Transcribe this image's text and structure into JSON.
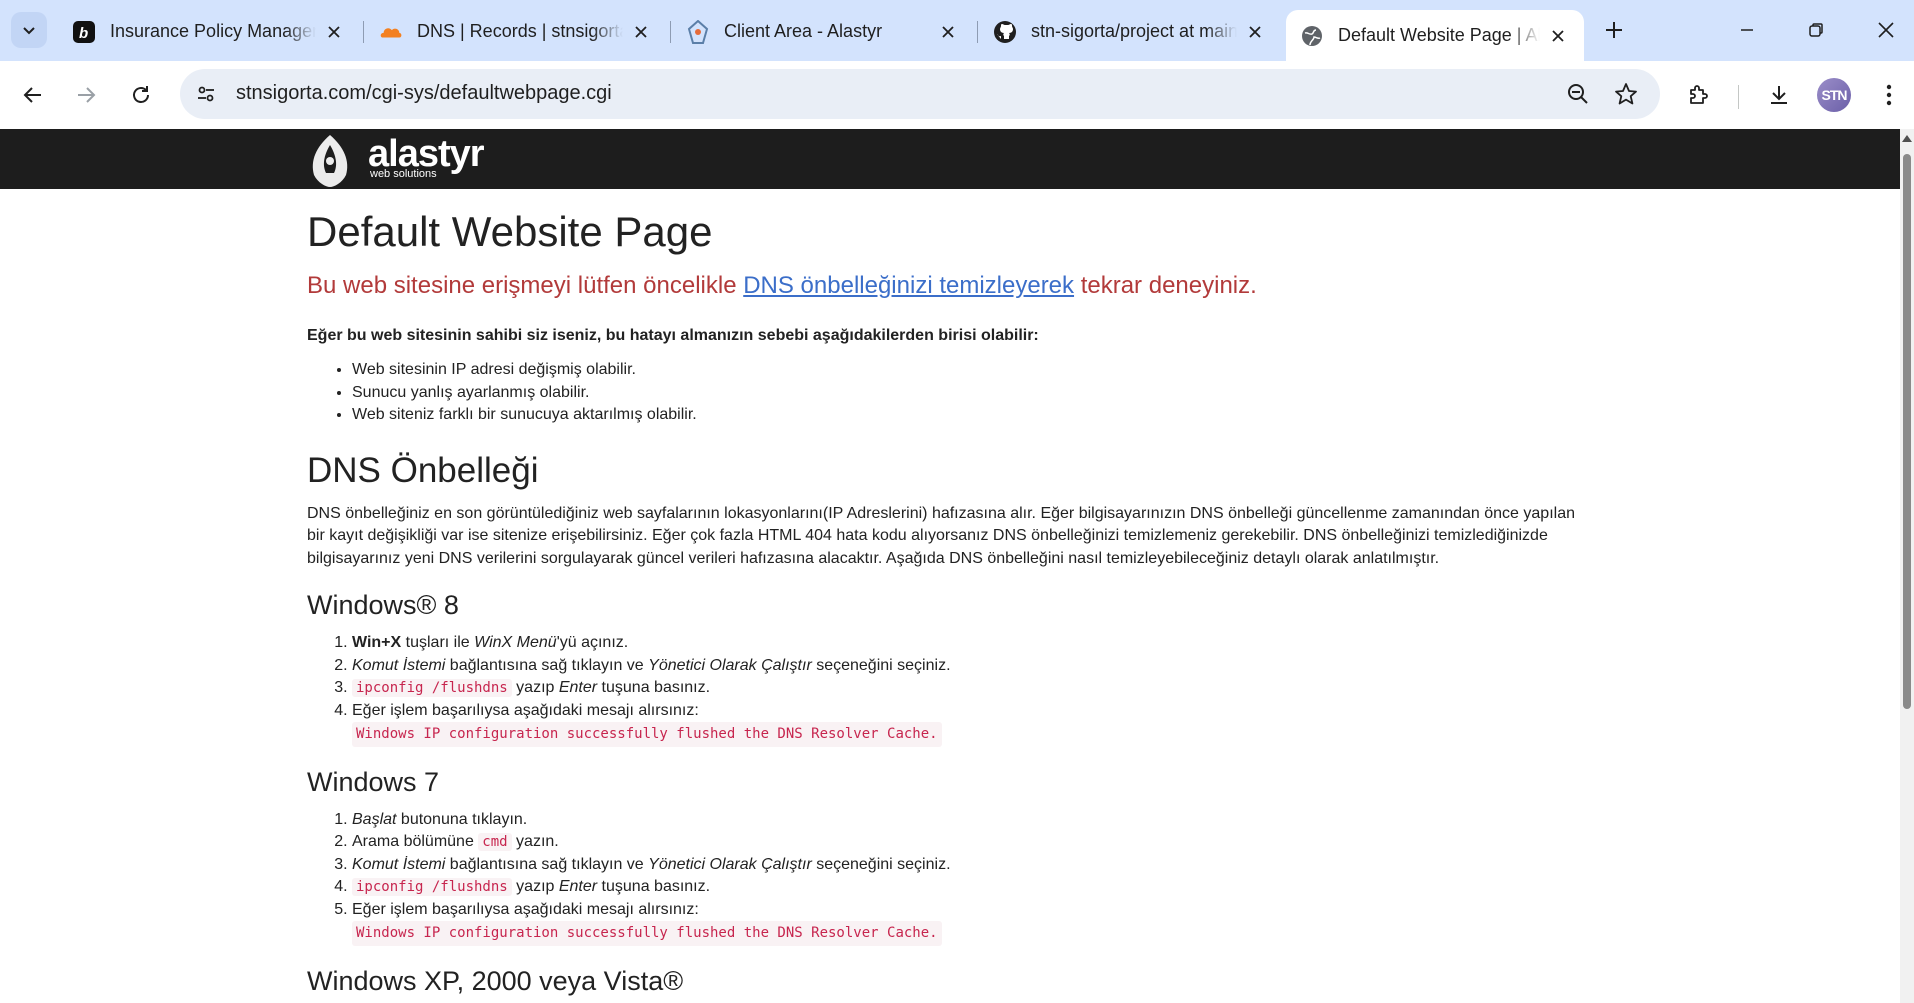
{
  "browser": {
    "tabs": [
      {
        "title": "Insurance Policy Management",
        "favicon": "b-brand-icon"
      },
      {
        "title": "DNS | Records | stnsigorta.com",
        "favicon": "cloudflare-icon"
      },
      {
        "title": "Client Area - Alastyr",
        "favicon": "alastyr-icon"
      },
      {
        "title": "stn-sigorta/project at main",
        "favicon": "github-icon"
      },
      {
        "title": "Default Website Page | Alastyr",
        "favicon": "globe-icon",
        "active": true
      }
    ],
    "address_bar": {
      "url": "stnsigorta.com/cgi-sys/defaultwebpage.cgi"
    },
    "profile_initials": "STN"
  },
  "page": {
    "logo": {
      "brand": "alastyr",
      "tagline": "web solutions"
    },
    "title": "Default Website Page",
    "lead_before": "Bu web sitesine erişmeyi lütfen öncelikle ",
    "lead_link": "DNS önbelleğinizi temizleyerek",
    "lead_after": " tekrar deneyiniz.",
    "owner_notice": "Eğer bu web sitesinin sahibi siz iseniz, bu hatayı almanızın sebebi aşağıdakilerden birisi olabilir:",
    "reasons": [
      "Web sitesinin IP adresi değişmiş olabilir.",
      "Sunucu yanlış ayarlanmış olabilir.",
      "Web siteniz farklı bir sunucuya aktarılmış olabilir."
    ],
    "dns_heading": "DNS Önbelleği",
    "dns_paragraph": "DNS önbelleğiniz en son görüntülediğiniz web sayfalarının lokasyonlarını(IP Adreslerini) hafızasına alır. Eğer bilgisayarınızın DNS önbelleği güncellenme zamanından önce yapılan bir kayıt değişikliği var ise sitenize erişebilirsiniz. Eğer çok fazla HTML 404 hata kodu alıyorsanız DNS önbelleğinizi temizlemeniz gerekebilir. DNS önbelleğinizi temizlediğinizde bilgisayarınız yeni DNS verilerini sorgulayarak güncel verileri hafızasına alacaktır. Aşağıda DNS önbelleğini nasıl temizleyebileceğiniz detaylı olarak anlatılmıştır.",
    "win8": {
      "heading": "Windows® 8",
      "s1_key": "Win+X",
      "s1_mid": " tuşları ile ",
      "s1_menu": "WinX Menü",
      "s1_end": "'yü açınız.",
      "s2_a": "Komut İstemi",
      "s2_b": " bağlantısına sağ tıklayın ve ",
      "s2_c": "Yönetici Olarak Çalıştır",
      "s2_d": " seçeneğini seçiniz.",
      "s3_code": "ipconfig /flushdns",
      "s3_b": " yazıp ",
      "s3_c": "Enter",
      "s3_d": " tuşuna basınız.",
      "s4": "Eğer işlem başarılıysa aşağıdaki mesajı alırsınız:",
      "s4_msg": "Windows IP configuration successfully flushed the DNS Resolver Cache."
    },
    "win7": {
      "heading": "Windows 7",
      "s1_a": "Başlat",
      "s1_b": " butonuna tıklayın.",
      "s2_a": "Arama bölümüne ",
      "s2_code": "cmd",
      "s2_b": " yazın.",
      "s3_a": "Komut İstemi",
      "s3_b": " bağlantısına sağ tıklayın ve ",
      "s3_c": "Yönetici Olarak Çalıştır",
      "s3_d": " seçeneğini seçiniz.",
      "s4_code": "ipconfig /flushdns",
      "s4_b": " yazıp ",
      "s4_c": "Enter",
      "s4_d": " tuşuna basınız.",
      "s5": "Eğer işlem başarılıysa aşağıdaki mesajı alırsınız:",
      "s5_msg": "Windows IP configuration successfully flushed the DNS Resolver Cache."
    },
    "winxp_heading": "Windows XP, 2000 veya Vista®"
  }
}
